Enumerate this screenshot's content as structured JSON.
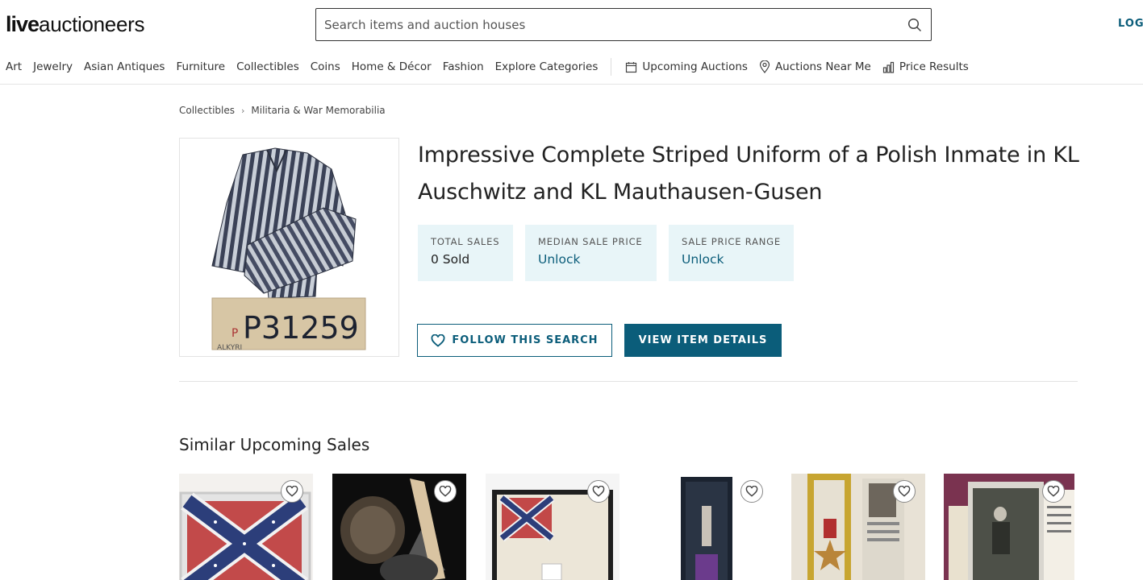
{
  "header": {
    "logo_bold": "live",
    "logo_light": "auctioneers",
    "search_placeholder": "Search items and auction houses",
    "login_label": "LOG"
  },
  "nav": {
    "categories": [
      "Art",
      "Jewelry",
      "Asian Antiques",
      "Furniture",
      "Collectibles",
      "Coins",
      "Home & Décor",
      "Fashion",
      "Explore Categories"
    ],
    "upcoming": "Upcoming Auctions",
    "near": "Auctions Near Me",
    "prices": "Price Results"
  },
  "breadcrumb": [
    "Collectibles",
    "Militaria & War Memorabilia"
  ],
  "item": {
    "title": "Impressive Complete Striped Uniform of a Polish Inmate in KL Auschwitz and KL Mauthausen-Gusen",
    "image_tag": "P31259",
    "image_watermark": "ALKYRI",
    "stats": [
      {
        "label": "TOTAL SALES",
        "value": "0 Sold"
      },
      {
        "label": "MEDIAN SALE PRICE",
        "value": "Unlock"
      },
      {
        "label": "SALE PRICE RANGE",
        "value": "Unlock"
      }
    ],
    "follow_label": "FOLLOW THIS SEARCH",
    "view_label": "VIEW ITEM DETAILS"
  },
  "similar": {
    "heading": "Similar Upcoming Sales",
    "cards": [
      {
        "subject": "framed confederate battle flag"
      },
      {
        "subject": "aviator helmet and propeller"
      },
      {
        "subject": "framed confederate flag"
      },
      {
        "subject": "purple heart medal in case"
      },
      {
        "subject": "bronze star medal with photo"
      },
      {
        "subject": "vintage soldier photograph"
      }
    ]
  },
  "colors": {
    "accent": "#0b5d7a",
    "stat_bg": "#e8f5f8"
  }
}
